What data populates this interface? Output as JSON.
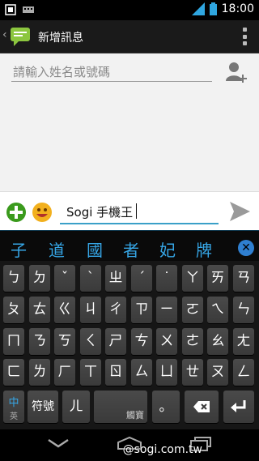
{
  "status_bar": {
    "time": "18:00"
  },
  "app_bar": {
    "title": "新增訊息"
  },
  "recipient": {
    "placeholder": "請輸入姓名或號碼"
  },
  "compose": {
    "text": "Sogi 手機王"
  },
  "candidates": [
    "子",
    "道",
    "國",
    "者",
    "妃",
    "牌"
  ],
  "keyboard": {
    "rows": [
      [
        "ㄅ",
        "ㄉ",
        "ˇ",
        "ˋ",
        "ㄓ",
        "ˊ",
        "˙",
        "ㄚ",
        "ㄞ",
        "ㄢ"
      ],
      [
        "ㄆ",
        "ㄊ",
        "ㄍ",
        "ㄐ",
        "ㄔ",
        "ㄗ",
        "ㄧ",
        "ㄛ",
        "ㄟ",
        "ㄣ"
      ],
      [
        "ㄇ",
        "ㄋ",
        "ㄎ",
        "ㄑ",
        "ㄕ",
        "ㄘ",
        "ㄨ",
        "ㄜ",
        "ㄠ",
        "ㄤ"
      ],
      [
        "ㄈ",
        "ㄌ",
        "ㄏ",
        "ㄒ",
        "ㄖ",
        "ㄙ",
        "ㄩ",
        "ㄝ",
        "ㄡ",
        "ㄥ"
      ]
    ],
    "lang_primary": "中",
    "lang_secondary": "英",
    "symbols": "符號",
    "er_key": "ㄦ",
    "space_label": "觸寶",
    "period": "。"
  },
  "watermark": "@sogi.com.tw",
  "colors": {
    "accent": "#3aa0c8",
    "candidate": "#36a6e6",
    "app_bar": "#1a1a1a"
  }
}
